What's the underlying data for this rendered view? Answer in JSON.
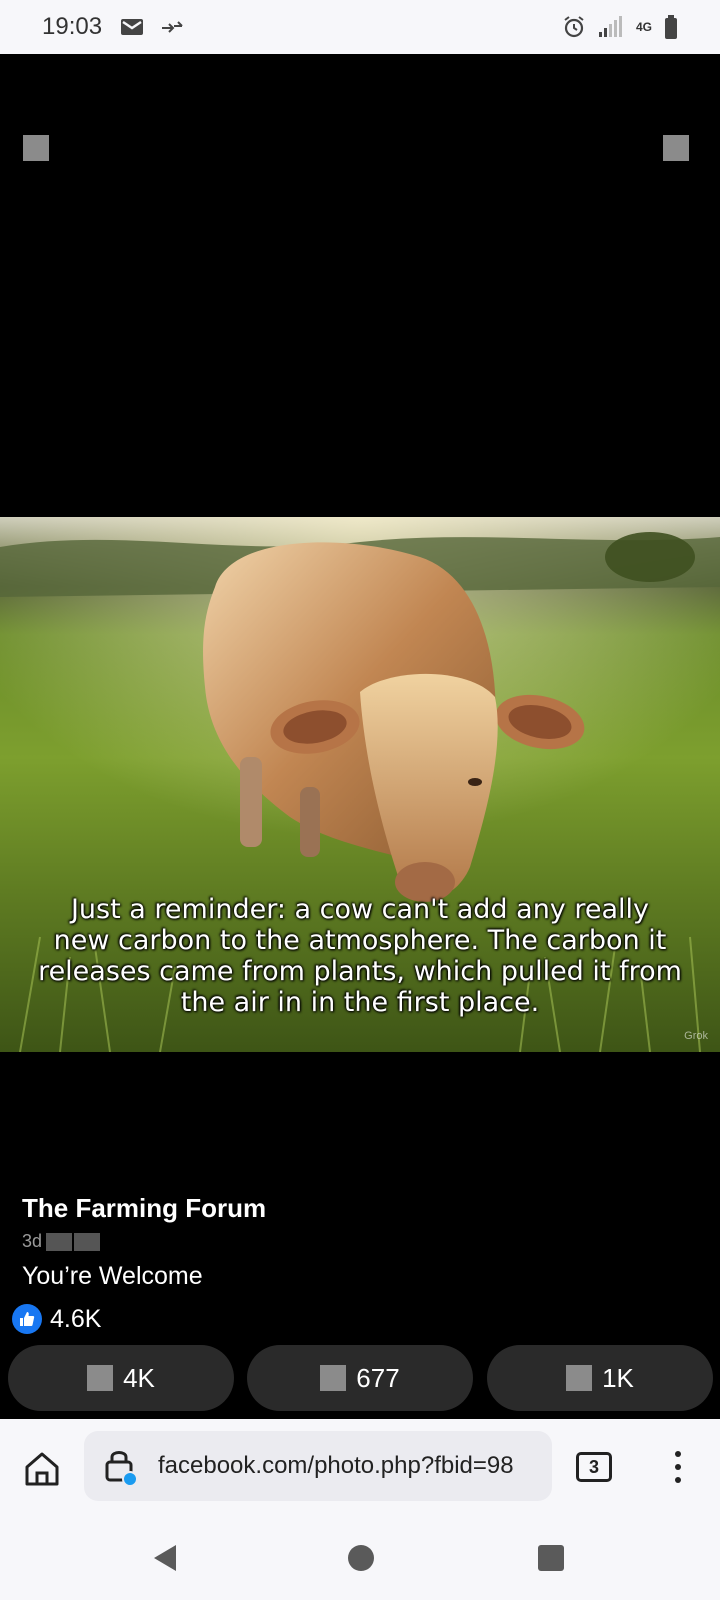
{
  "status_bar": {
    "time": "19:03",
    "network": "4G",
    "icons": [
      "mail-icon",
      "data-transfer-icon",
      "alarm-icon",
      "signal-icon",
      "battery-icon"
    ]
  },
  "photo": {
    "caption_lines": [
      "Just a reminder: a cow can't add any really",
      "new carbon to the atmosphere. The carbon it",
      "releases came from plants, which pulled it from",
      "the air in in the first place."
    ],
    "watermark": "Grok"
  },
  "post": {
    "page_name": "The Farming Forum",
    "time": "3d",
    "caption": "You’re Welcome",
    "reaction_count": "4.6K"
  },
  "actions": {
    "like_count": "4K",
    "comment_count": "677",
    "share_count": "1K"
  },
  "browser": {
    "url": "facebook.com/photo.php?fbid=98",
    "tab_count": "3"
  },
  "colors": {
    "facebook_blue": "#1877f2",
    "action_button_bg": "#2a2a2a",
    "chrome_bg": "#f7f7fa"
  }
}
